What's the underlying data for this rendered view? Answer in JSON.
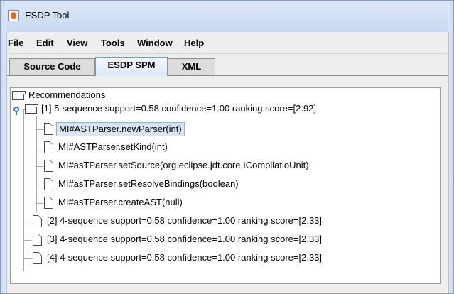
{
  "window": {
    "title": "ESDP Tool"
  },
  "menu": {
    "items": [
      "File",
      "Edit",
      "View",
      "Tools",
      "Window",
      "Help"
    ]
  },
  "tabs": [
    {
      "label": "Source Code",
      "active": false
    },
    {
      "label": "ESDP SPM",
      "active": true
    },
    {
      "label": "XML",
      "active": false
    }
  ],
  "tree": {
    "root": "Recommendations",
    "expanded_node": "[1] 5-sequence support=0.58 confidence=1.00 ranking score=[2.92]",
    "children": [
      "MI#ASTParser.newParser(int)",
      "MI#ASTParser.setKind(int)",
      "MI#asTParser.setSource(org.eclipse.jdt.core.ICompilatioUnit)",
      "MI#asTParser.setResolveBindings(boolean)",
      "MI#asTParser.createAST(null)"
    ],
    "collapsed_nodes": [
      "[2] 4-sequence support=0.58 confidence=1.00 ranking score=[2.33]",
      "[3] 4-sequence support=0.58 confidence=1.00 ranking score=[2.33]",
      "[4] 4-sequence support=0.58 confidence=1.00 ranking score=[2.33]"
    ],
    "selected_index": 0
  },
  "colors": {
    "selection": "#dbe6f5",
    "selection_border": "#8fb0d8",
    "titlebar": "#c9daf0"
  },
  "icons": {
    "app": "java-cup-icon",
    "root": "folder-icon",
    "leaf": "document-icon",
    "expander": "toggle-expanded-icon"
  }
}
